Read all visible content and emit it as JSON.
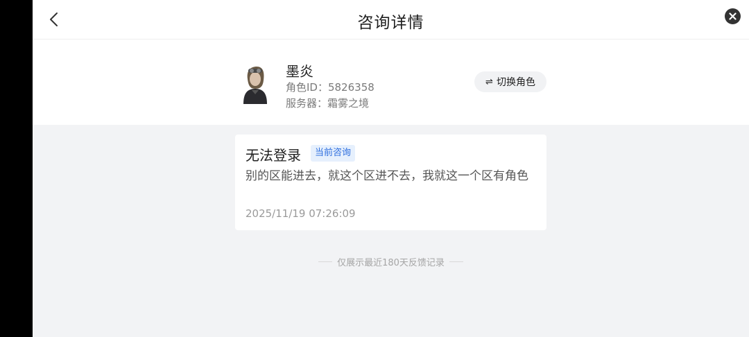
{
  "header": {
    "title": "咨询详情",
    "back_icon": "chevron-left-icon",
    "close_icon": "close-icon"
  },
  "profile": {
    "name": "墨炎",
    "id_text": "角色ID：5826358",
    "server_text": "服务器：霜雾之境",
    "switch_label": "切换角色",
    "switch_icon": "swap-icon"
  },
  "consultation": {
    "title": "无法登录",
    "badge": "当前咨询",
    "body": "别的区能进去，就这个区进不去，我就这一个区有角色",
    "time": "2025/11/19 07:26:09"
  },
  "footer": {
    "note": "仅展示最近180天反馈记录"
  },
  "colors": {
    "accent": "#2f6fde",
    "badge_bg": "#e6f0fd",
    "page_bg": "#f2f3f5"
  }
}
